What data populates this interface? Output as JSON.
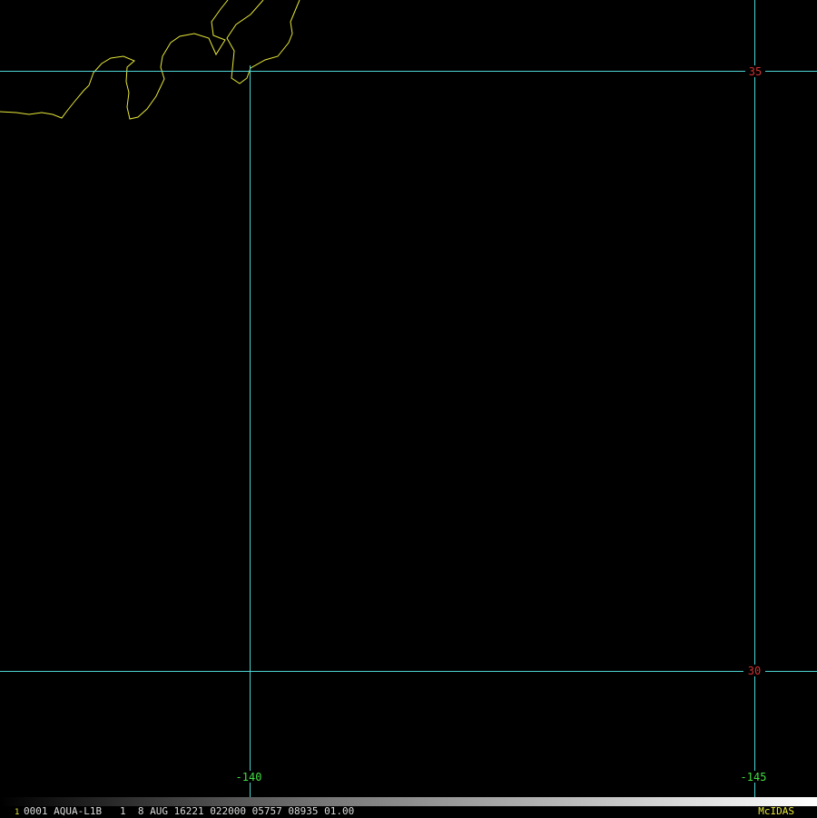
{
  "map": {
    "lat_labels": [
      "35",
      "30"
    ],
    "lon_labels": [
      "-140",
      "-145"
    ],
    "colors": {
      "background": "#000000",
      "gridlines": "#4fd4d4",
      "coastline": "#e8e83a",
      "lat_label": "#d03030",
      "lon_label": "#44dd44"
    }
  },
  "status_bar": {
    "frame_number": "1",
    "text": "0001 AQUA-L1B   1  8 AUG 16221 022000 05757 08935 01.00",
    "brand": "McIDAS"
  }
}
